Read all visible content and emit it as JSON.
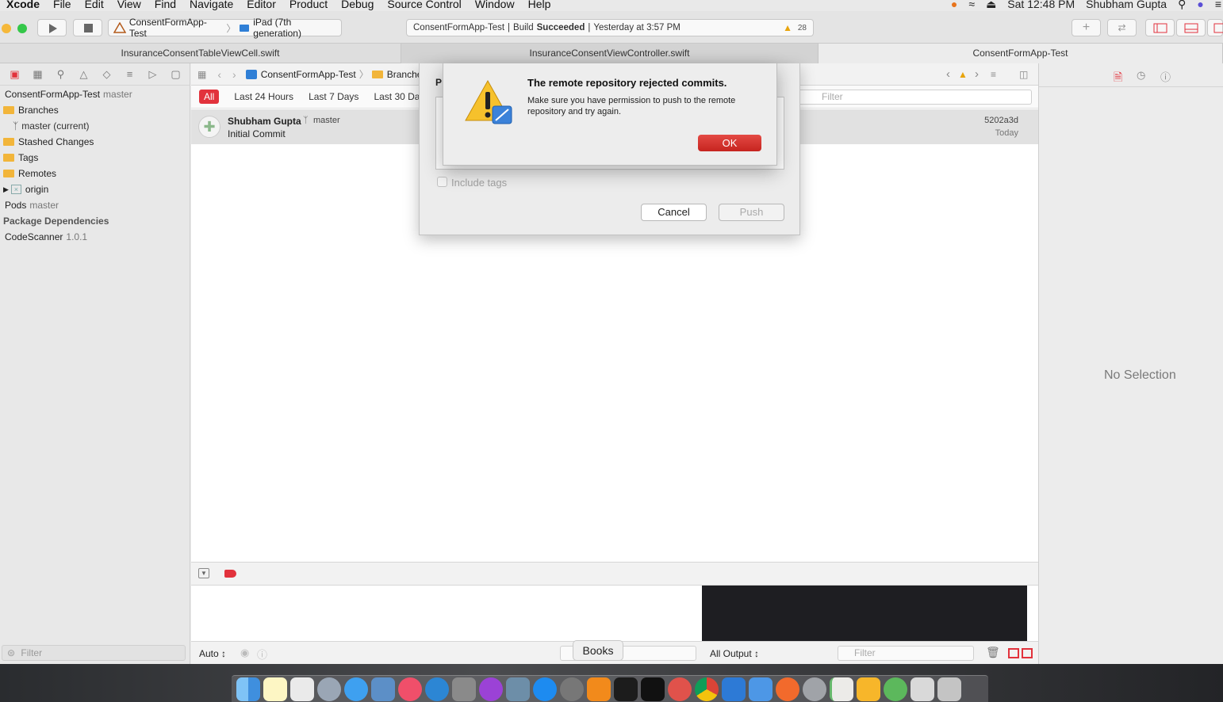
{
  "menubar": {
    "apple": "",
    "items": [
      "Xcode",
      "File",
      "Edit",
      "View",
      "Find",
      "Navigate",
      "Editor",
      "Product",
      "Debug",
      "Source Control",
      "Window",
      "Help"
    ],
    "clock": "Sat 12:48 PM",
    "user": "Shubham Gupta"
  },
  "toolbar": {
    "scheme": "ConsentFormApp-Test",
    "device": "iPad (7th generation)",
    "activity_project": "ConsentFormApp-Test",
    "activity_build": "Build",
    "activity_status": "Succeeded",
    "activity_time": "Yesterday at 3:57 PM",
    "warnings": "28"
  },
  "tabs": [
    "InsuranceConsentTableViewCell.swift",
    "InsuranceConsentViewController.swift",
    "ConsentFormApp-Test"
  ],
  "navigator": {
    "project": "ConsentFormApp-Test",
    "project_branch": "master",
    "branches": "Branches",
    "master": "master (current)",
    "stashed": "Stashed Changes",
    "tags": "Tags",
    "remotes": "Remotes",
    "origin": "origin",
    "pods": "Pods",
    "pods_branch": "master",
    "package_deps": "Package Dependencies",
    "codescanner": "CodeScanner",
    "codescanner_version": "1.0.1",
    "filter_placeholder": "Filter"
  },
  "editor": {
    "crumb_project": "ConsentFormApp-Test",
    "crumb_branches": "Branche",
    "filters": [
      "All",
      "Last 24 Hours",
      "Last 7 Days",
      "Last 30 Day"
    ],
    "filter_placeholder": "Filter",
    "commit": {
      "author": "Shubham Gupta",
      "branch": "master",
      "message": "Initial Commit",
      "hash": "5202a3d",
      "date": "Today"
    }
  },
  "push_sheet": {
    "title_fragment": "P",
    "include_tags": "Include tags",
    "cancel": "Cancel",
    "push": "Push"
  },
  "alert": {
    "title": "The remote repository rejected commits.",
    "message": "Make sure you have permission to push to the remote repository and try again.",
    "ok": "OK"
  },
  "debug": {
    "auto": "Auto ↕",
    "output": "All Output ↕",
    "filter_placeholder": "Filter"
  },
  "inspector": {
    "no_selection": "No Selection"
  },
  "dock": {
    "tooltip": "Books"
  }
}
